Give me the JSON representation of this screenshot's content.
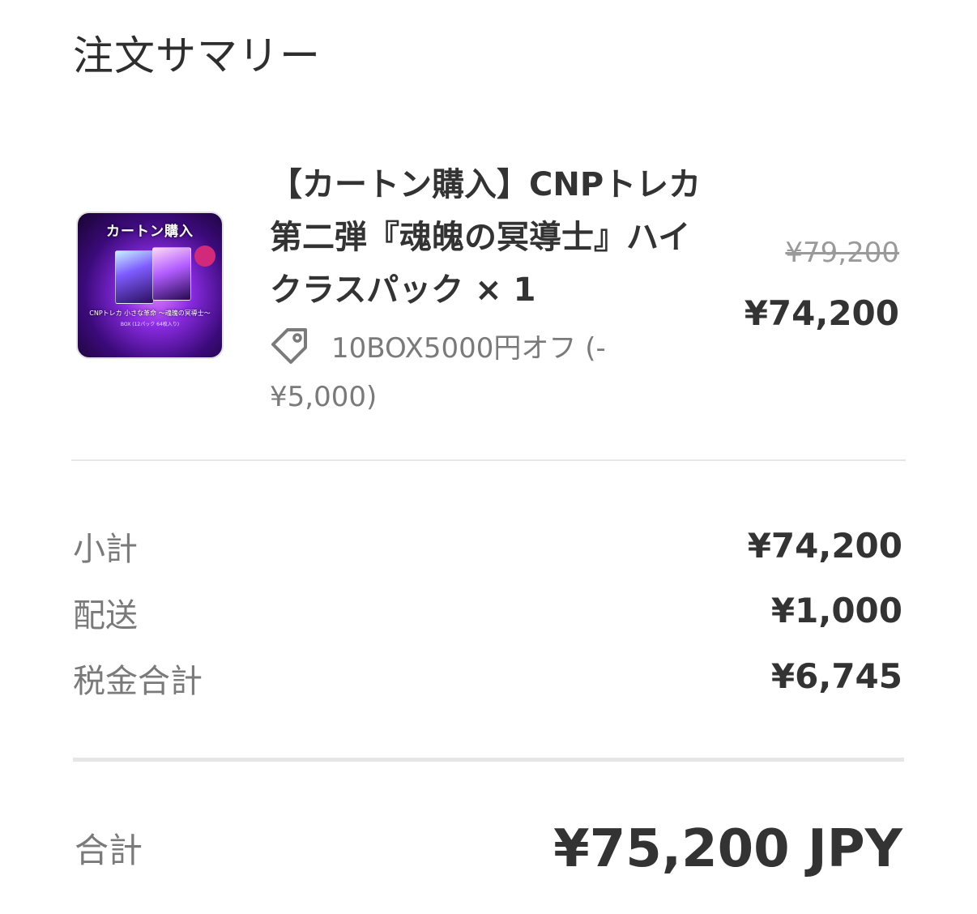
{
  "summary": {
    "title": "注文サマリー"
  },
  "item": {
    "thumbnail_text": "カートン購入",
    "thumbnail_caption": "CNPトレカ 小さな革命 ～魂魄の冥導士～",
    "thumbnail_subcaption": "BOX (12パック 64枚入り)",
    "name": "【カートン購入】CNPトレカ第二弾『魂魄の冥導士』ハイクラスパック",
    "quantity": "× 1",
    "discount_label": "10BOX5000円オフ (-¥5,000)",
    "original_price": "¥79,200",
    "price": "¥74,200",
    "tag_icon": "tag-icon"
  },
  "totals": {
    "subtotal_label": "小計",
    "subtotal_value": "¥74,200",
    "shipping_label": "配送",
    "shipping_value": "¥1,000",
    "tax_label": "税金合計",
    "tax_value": "¥6,745",
    "total_label": "合計",
    "total_value": "¥75,200 JPY"
  }
}
